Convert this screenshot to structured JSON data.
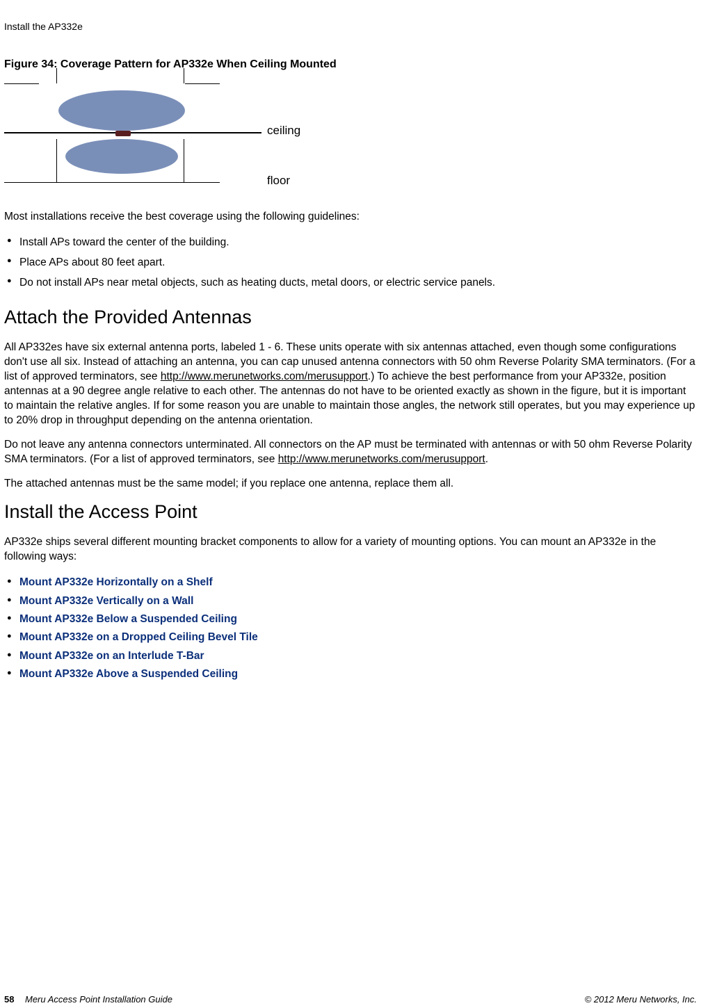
{
  "header": {
    "running_title": "Install the AP332e"
  },
  "figure": {
    "caption": "Figure 34: Coverage Pattern for AP332e When Ceiling Mounted",
    "label_ceiling": "ceiling",
    "label_floor": "floor"
  },
  "intro_after_figure": "Most installations receive the best coverage using the following guidelines:",
  "guidelines": [
    "Install APs toward the center of the building.",
    "Place APs about 80 feet apart.",
    "Do not install APs near metal objects, such as heating ducts, metal doors, or electric service panels."
  ],
  "section_antennas": {
    "heading": "Attach the Provided Antennas",
    "p1_a": "All AP332es have six external antenna ports, labeled 1 - 6. These units operate with six antennas attached, even though some configurations don't use all six. Instead of attaching an antenna, you can cap unused antenna connectors with 50 ohm Reverse Polarity SMA terminators. (For a list of approved terminators, see ",
    "p1_link": "http://www.merunetworks.com/merusupport",
    "p1_b": ".) To achieve the best performance from your AP332e, position antennas at a 90 degree angle relative to each other. The antennas do not have to be oriented exactly as shown in the figure, but it is important to maintain the relative angles. If for some reason you are unable to maintain those angles, the network still operates, but you may experience up to 20% drop in throughput depending on the antenna orientation.",
    "p2_a": "Do not leave any antenna connectors unterminated. All connectors on the AP must be terminated with antennas or with 50 ohm Reverse Polarity SMA terminators. (For a list of approved terminators, see ",
    "p2_link": "http://www.merunetworks.com/merusupport",
    "p2_b": ".",
    "p3": "The attached antennas must be the same model; if you replace one antenna, replace them all."
  },
  "section_install": {
    "heading": "Install the Access Point",
    "intro": "AP332e ships several different mounting bracket components to allow for a variety of mounting options. You can mount an AP332e in the following ways:",
    "links": [
      "Mount AP332e Horizontally on a Shelf",
      "Mount AP332e Vertically on a Wall",
      "Mount AP332e Below a Suspended Ceiling",
      "Mount AP332e on a Dropped Ceiling Bevel Tile",
      "Mount AP332e on an Interlude T-Bar",
      "Mount AP332e Above a Suspended Ceiling"
    ]
  },
  "footer": {
    "page_number": "58",
    "doc_title": "Meru Access Point Installation Guide",
    "copyright": "© 2012 Meru Networks, Inc."
  }
}
